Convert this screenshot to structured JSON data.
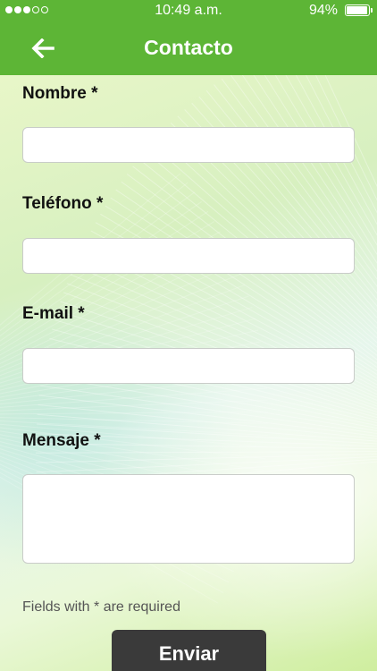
{
  "status_bar": {
    "time": "10:49 a.m.",
    "battery_percent": "94%",
    "battery_level": 0.94,
    "signal_bars_filled": 3,
    "signal_bars_total": 5
  },
  "header": {
    "title": "Contacto",
    "back_icon": "arrow-left-icon",
    "background_color": "#5db536"
  },
  "form": {
    "fields": [
      {
        "label": "Nombre *",
        "value": "",
        "type": "text"
      },
      {
        "label": "Teléfono *",
        "value": "",
        "type": "tel"
      },
      {
        "label": "E-mail *",
        "value": "",
        "type": "email"
      },
      {
        "label": "Mensaje *",
        "value": "",
        "type": "textarea"
      }
    ],
    "required_note": "Fields with * are required",
    "submit_label": "Enviar"
  }
}
